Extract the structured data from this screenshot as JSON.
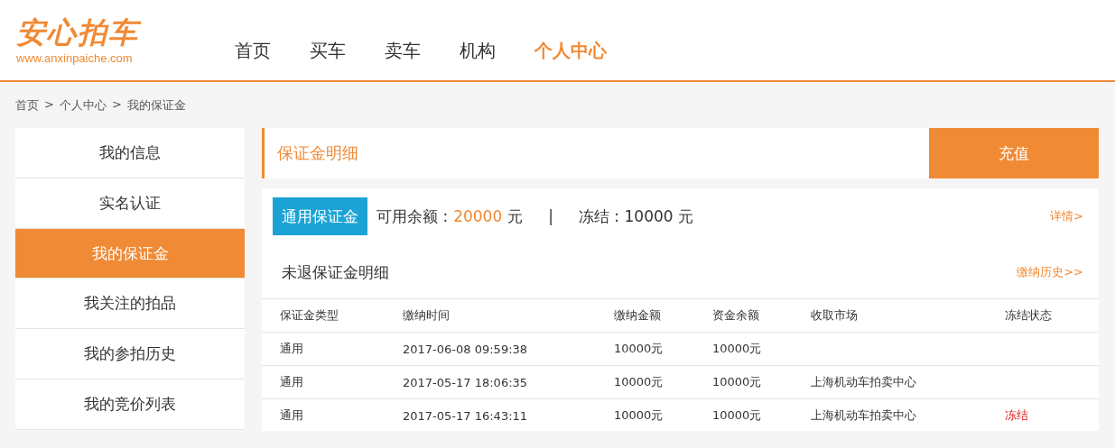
{
  "logo": {
    "name": "安心拍车",
    "url": "www.anxinpaiche.com"
  },
  "nav": [
    {
      "label": "首页",
      "selected": false
    },
    {
      "label": "买车",
      "selected": false
    },
    {
      "label": "卖车",
      "selected": false
    },
    {
      "label": "机构",
      "selected": false
    },
    {
      "label": "个人中心",
      "selected": true
    }
  ],
  "breadcrumb": [
    "首页",
    "个人中心",
    "我的保证金"
  ],
  "breadcrumb_separator": ">",
  "sidebar": {
    "items": [
      {
        "label": "我的信息",
        "selected": false
      },
      {
        "label": "实名认证",
        "selected": false
      },
      {
        "label": "我的保证金",
        "selected": true
      },
      {
        "label": "我关注的拍品",
        "selected": false
      },
      {
        "label": "我的参拍历史",
        "selected": false
      },
      {
        "label": "我的竞价列表",
        "selected": false
      }
    ]
  },
  "header": {
    "title": "保证金明细",
    "button": "充值"
  },
  "summary": {
    "badge": "通用保证金",
    "available_label": "可用余额 :",
    "available_amount": "20000",
    "available_unit": "元",
    "separator": "|",
    "frozen": "冻结 : 10000 元",
    "details_link": "详情>"
  },
  "section": {
    "title": "未退保证金明细",
    "history_link": "缴纳历史>>"
  },
  "table": {
    "columns": [
      "保证金类型",
      "缴纳时间",
      "缴纳金额",
      "资金余额",
      "收取市场",
      "冻结状态"
    ],
    "rows": [
      {
        "type": "通用",
        "time": "2017-06-08 09:59:38",
        "paid": "10000元",
        "balance": "10000元"
      },
      {
        "type": "通用",
        "time": "2017-05-17 18:06:35",
        "paid": "10000元",
        "balance": "10000元",
        "market": "上海机动车拍卖中心"
      },
      {
        "type": "通用",
        "time": "2017-05-17 16:43:11",
        "paid": "10000元",
        "balance": "10000元",
        "market": "上海机动车拍卖中心",
        "status": "冻结"
      }
    ]
  }
}
